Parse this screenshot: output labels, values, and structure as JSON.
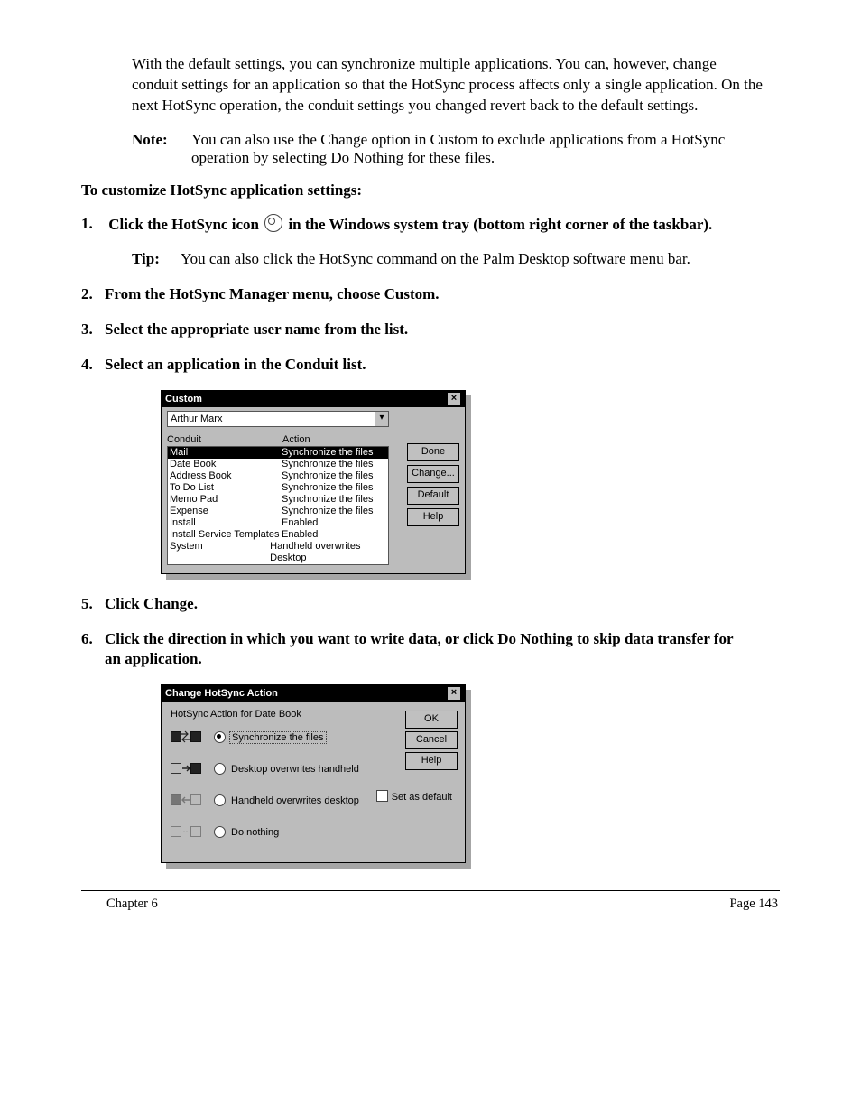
{
  "chapter": {
    "title": "Chapter 6",
    "page": "Page 143"
  },
  "intro": {
    "lead": "With the default settings, you can synchronize multiple applications. You can, however, change conduit settings for an application so that the HotSync process affects only a single application. On the next HotSync operation, the conduit settings you changed revert back to the default settings.",
    "note_label": "Note:",
    "note": "You can also use the Change option in Custom to exclude applications from a HotSync operation by selecting Do Nothing for these files."
  },
  "steps": [
    {
      "num": "1.",
      "txt": "Click the HotSync icon"
    },
    {
      "post": " in the Windows system tray (bottom right corner of the taskbar)."
    },
    {
      "tip_label": "Tip:",
      "tip": "You can also click the HotSync command on the Palm Desktop software menu bar."
    },
    {
      "num": "2.",
      "txt": "From the HotSync Manager menu, choose Custom."
    },
    {
      "num": "3.",
      "txt": "Select the appropriate user name from the list."
    },
    {
      "num": "4.",
      "txt": "Select an application in the Conduit list."
    },
    {
      "num": "5.",
      "txt": "Click Change."
    },
    {
      "num": "6.",
      "txt": "Click the direction in which you want to write data, or click Do Nothing to skip data transfer for an application."
    }
  ],
  "custom_dialog": {
    "title": "Custom",
    "user": "Arthur Marx",
    "col1": "Conduit",
    "col2": "Action",
    "rows": [
      {
        "c1": "Mail",
        "c2": "Synchronize the files",
        "sel": true
      },
      {
        "c1": "Date Book",
        "c2": "Synchronize the files"
      },
      {
        "c1": "Address Book",
        "c2": "Synchronize the files"
      },
      {
        "c1": "To Do List",
        "c2": "Synchronize the files"
      },
      {
        "c1": "Memo Pad",
        "c2": "Synchronize the files"
      },
      {
        "c1": "Expense",
        "c2": "Synchronize the files"
      },
      {
        "c1": "Install",
        "c2": "Enabled"
      },
      {
        "c1": "Install Service Templates",
        "c2": "Enabled"
      },
      {
        "c1": "System",
        "c2": "Handheld overwrites Desktop"
      }
    ],
    "buttons": {
      "done": "Done",
      "change": "Change...",
      "default": "Default",
      "help": "Help"
    }
  },
  "change_dialog": {
    "title": "Change HotSync Action",
    "label": "HotSync Action for Date Book",
    "options": [
      {
        "text": "Synchronize the files",
        "sel": true
      },
      {
        "text": "Desktop overwrites handheld"
      },
      {
        "text": "Handheld overwrites desktop"
      },
      {
        "text": "Do nothing"
      }
    ],
    "buttons": {
      "ok": "OK",
      "cancel": "Cancel",
      "help": "Help"
    },
    "set_default": "Set as default"
  }
}
